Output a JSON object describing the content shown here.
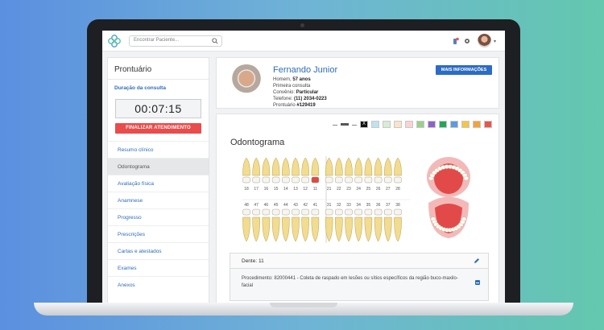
{
  "search": {
    "placeholder": "Encontrar Paciente..."
  },
  "sidebar": {
    "title": "Prontuário",
    "duration_label": "Duração da consulta",
    "timer": "00:07:15",
    "finish_button": "FINALIZAR ATENDIMENTO",
    "items": [
      {
        "label": "Resumo clínico"
      },
      {
        "label": "Odontograma"
      },
      {
        "label": "Avaliação física"
      },
      {
        "label": "Anamnese"
      },
      {
        "label": "Progresso"
      },
      {
        "label": "Prescrições"
      },
      {
        "label": "Cartas e atestados"
      },
      {
        "label": "Exames"
      },
      {
        "label": "Anexos"
      }
    ],
    "active_item": "Odontograma"
  },
  "patient": {
    "name": "Fernando Junior",
    "gender_age_prefix": "Homem, ",
    "age": "57 anos",
    "visit": "Primeira consulta",
    "insurance_label": "Convênio: ",
    "insurance": "Particular",
    "phone_label": "Telefone: ",
    "phone": "(11) 2034-0223",
    "record_label": "Prontuário ",
    "record": "#129419",
    "more_button": "MAIS INFORMAÇÕES"
  },
  "odontograma": {
    "title": "Odontograma",
    "swatch_x": "X",
    "colors": [
      "#ffffff",
      "#555555",
      "#ffffff",
      "#111111",
      "#bfe3ee",
      "#d8ecd2",
      "#fbe3c8",
      "#f8d3d3",
      "#9ad08a",
      "#8e63c9",
      "#25a55a",
      "#5b9be0",
      "#f4c542",
      "#f2a33a",
      "#e8574b"
    ],
    "upper_numbers": [
      "18",
      "17",
      "16",
      "15",
      "14",
      "13",
      "12",
      "11",
      "21",
      "22",
      "23",
      "24",
      "25",
      "26",
      "27",
      "28"
    ],
    "lower_numbers": [
      "48",
      "47",
      "46",
      "45",
      "44",
      "43",
      "42",
      "41",
      "31",
      "32",
      "33",
      "34",
      "35",
      "36",
      "37",
      "38"
    ],
    "selected_tooth": "11",
    "selected_color": "#e04a3e"
  },
  "dente": {
    "title": "Dente: 11",
    "procedure": "Procedimento: 82000441 - Coleta de raspado em lesões ou sítios específicos da região buco-maxilo-facial"
  }
}
